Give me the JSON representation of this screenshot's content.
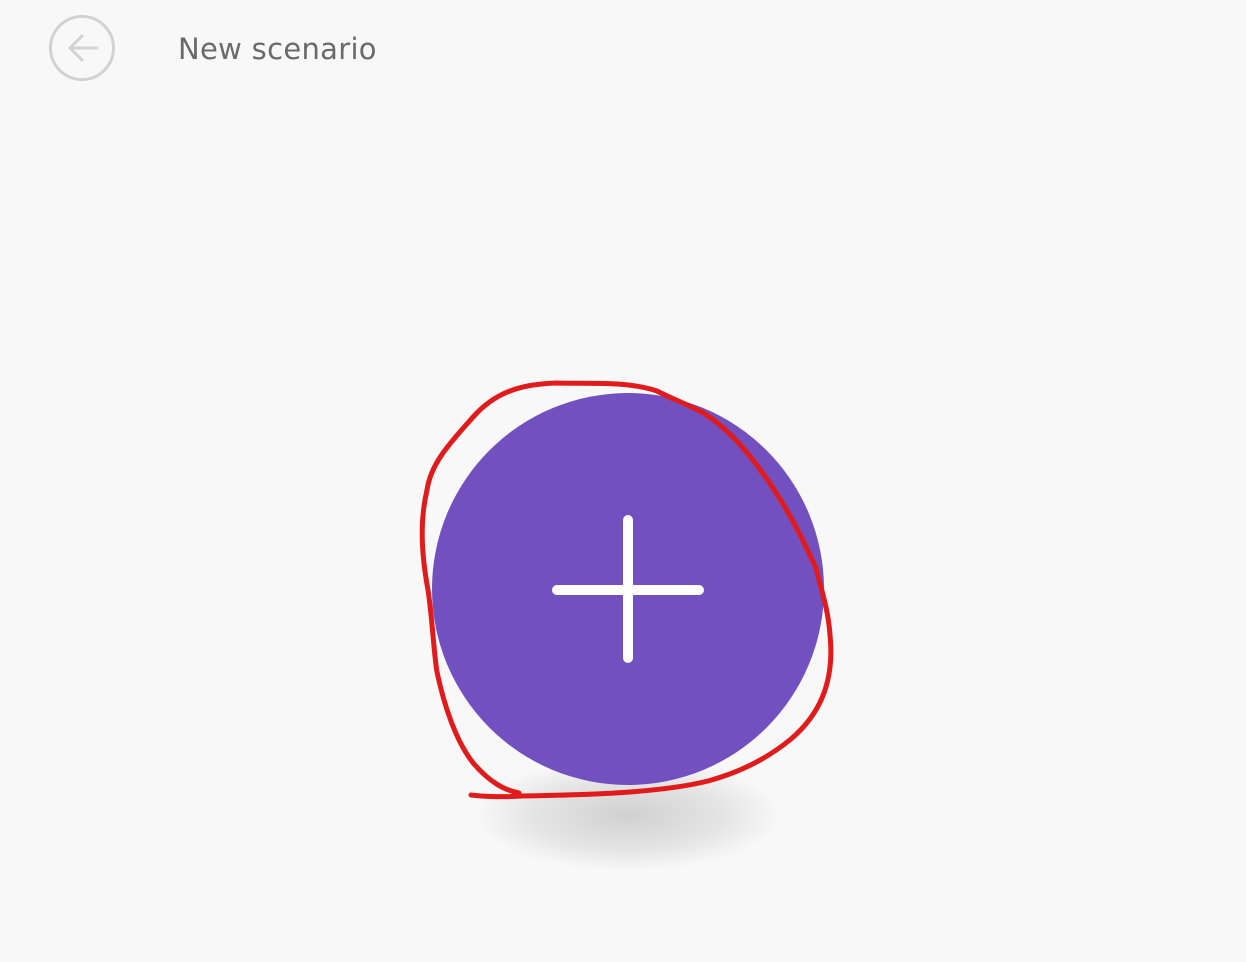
{
  "header": {
    "title": "New scenario",
    "back_icon": "arrow-left-icon"
  },
  "main": {
    "add_icon": "plus-icon",
    "accent_color": "#7350bf"
  },
  "annotation": {
    "color": "#e11b1b",
    "shape": "hand-drawn circle around add button"
  }
}
